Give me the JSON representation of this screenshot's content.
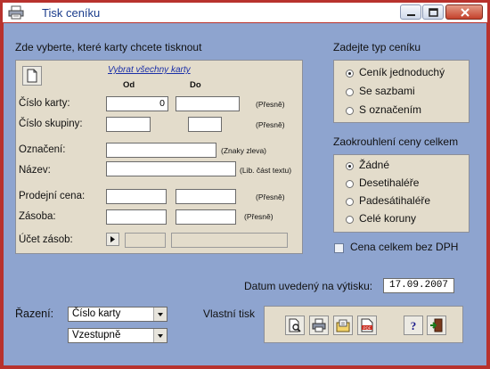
{
  "window": {
    "title": "Tisk ceníku"
  },
  "cards_section": {
    "heading": "Zde vyberte, které karty chcete tisknout",
    "select_all_link": "Vybrat  všechny karty",
    "col_from": "Od",
    "col_to": "Do",
    "rows": {
      "card_number": {
        "label": "Číslo karty:",
        "from_value": "0",
        "note": "(Přesně)"
      },
      "group_number": {
        "label": "Číslo skupiny:",
        "note": "(Přesně)"
      },
      "marking": {
        "label": "Označení:",
        "note": "(Znaky zleva)"
      },
      "name": {
        "label": "Název:",
        "note": "(Lib. část textu)"
      },
      "sale_price": {
        "label": "Prodejní cena:",
        "note": "(Přesně)"
      },
      "stock": {
        "label": "Zásoba:",
        "note": "(Přesně)"
      },
      "stock_account": {
        "label": "Účet zásob:"
      }
    }
  },
  "price_type": {
    "heading": "Zadejte typ ceníku",
    "options": [
      {
        "label": "Ceník jednoduchý",
        "selected": true
      },
      {
        "label": "Se sazbami",
        "selected": false
      },
      {
        "label": "S označením",
        "selected": false
      }
    ]
  },
  "rounding": {
    "heading": "Zaokrouhlení ceny celkem",
    "options": [
      {
        "label": "Žádné",
        "selected": true
      },
      {
        "label": "Desetihaléře",
        "selected": false
      },
      {
        "label": "Padesátihaléře",
        "selected": false
      },
      {
        "label": "Celé koruny",
        "selected": false
      }
    ]
  },
  "price_without_vat": {
    "label": "Cena celkem bez DPH",
    "checked": false
  },
  "print_date": {
    "label": "Datum uvedený na výtisku:",
    "value": "17.09.2007"
  },
  "sorting": {
    "label": "Řazení:",
    "field_value": "Číslo karty",
    "order_value": "Vzestupně"
  },
  "custom_print": {
    "label": "Vlastní tisk"
  },
  "icons": {
    "app": "printer-icon",
    "new_doc": "blank-document-icon",
    "preview": "print-preview-icon",
    "print": "printer-icon",
    "export": "export-document-icon",
    "pdf": "pdf-icon",
    "help": "help-icon",
    "exit": "exit-door-icon"
  },
  "colors": {
    "frame": "#b8322d",
    "client": "#8ea4cf",
    "panel": "#e3dccb",
    "title_text": "#1a3c8c"
  }
}
